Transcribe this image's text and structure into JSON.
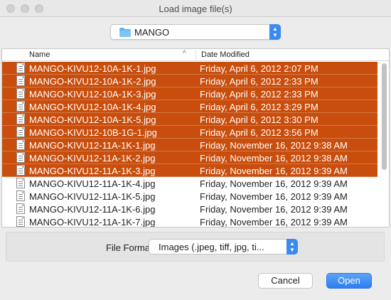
{
  "window": {
    "title": "Load image file(s)"
  },
  "path_popup": {
    "label": "MANGO"
  },
  "columns": {
    "name": "Name",
    "date": "Date Modified"
  },
  "files": [
    {
      "name": "MANGO-KIVU12-10A-1K-1.jpg",
      "date": "Friday, April 6, 2012 2:07 PM",
      "selected": true
    },
    {
      "name": "MANGO-KIVU12-10A-1K-2.jpg",
      "date": "Friday, April 6, 2012 2:33 PM",
      "selected": true
    },
    {
      "name": "MANGO-KIVU12-10A-1K-3.jpg",
      "date": "Friday, April 6, 2012 2:33 PM",
      "selected": true
    },
    {
      "name": "MANGO-KIVU12-10A-1K-4.jpg",
      "date": "Friday, April 6, 2012 3:29 PM",
      "selected": true
    },
    {
      "name": "MANGO-KIVU12-10A-1K-5.jpg",
      "date": "Friday, April 6, 2012 3:30 PM",
      "selected": true
    },
    {
      "name": "MANGO-KIVU12-10B-1G-1.jpg",
      "date": "Friday, April 6, 2012 3:56 PM",
      "selected": true
    },
    {
      "name": "MANGO-KIVU12-11A-1K-1.jpg",
      "date": "Friday, November 16, 2012 9:38 AM",
      "selected": true
    },
    {
      "name": "MANGO-KIVU12-11A-1K-2.jpg",
      "date": "Friday, November 16, 2012 9:38 AM",
      "selected": true
    },
    {
      "name": "MANGO-KIVU12-11A-1K-3.jpg",
      "date": "Friday, November 16, 2012 9:39 AM",
      "selected": true
    },
    {
      "name": "MANGO-KIVU12-11A-1K-4.jpg",
      "date": "Friday, November 16, 2012 9:39 AM",
      "selected": false
    },
    {
      "name": "MANGO-KIVU12-11A-1K-5.jpg",
      "date": "Friday, November 16, 2012 9:39 AM",
      "selected": false
    },
    {
      "name": "MANGO-KIVU12-11A-1K-6.jpg",
      "date": "Friday, November 16, 2012 9:39 AM",
      "selected": false
    },
    {
      "name": "MANGO-KIVU12-11A-1K-7.jpg",
      "date": "Friday, November 16, 2012 9:39 AM",
      "selected": false
    }
  ],
  "file_format": {
    "label": "File Format:",
    "value": "Images (.jpeg, tiff, jpg, ti..."
  },
  "buttons": {
    "cancel": "Cancel",
    "open": "Open"
  },
  "colors": {
    "selection": "#c94e0d",
    "accent": "#3b8af0"
  }
}
